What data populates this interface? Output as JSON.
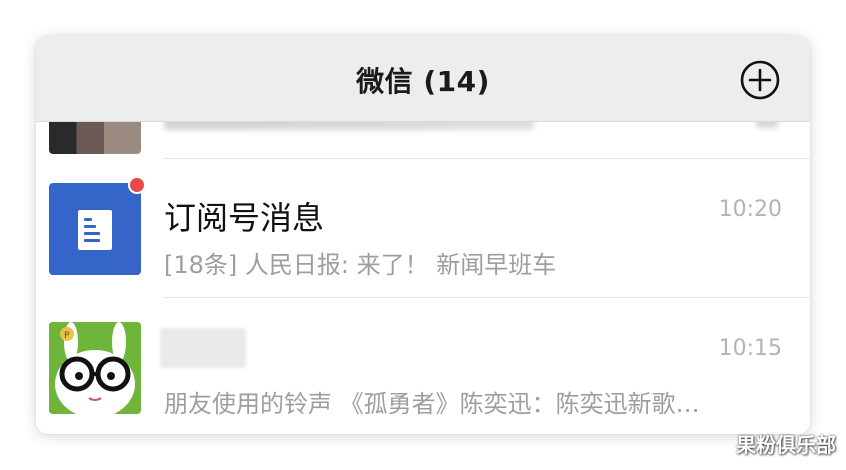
{
  "header": {
    "title": "微信 (14)",
    "add_icon": "plus-circle-icon"
  },
  "chats": [
    {
      "title": "订阅号消息",
      "time": "10:20",
      "preview": "[18条] 人民日报: 来了！ 新闻早班车",
      "avatar_icon": "subscription-document-icon",
      "avatar_color": "#3565c9",
      "unread_dot": true
    },
    {
      "title": "",
      "time": "10:15",
      "preview": "朋友使用的铃声 《孤勇者》陈奕迅：陈奕迅新歌…",
      "avatar_icon": "bunny-glasses-icon",
      "avatar_color": "#6fb53a"
    }
  ],
  "watermark": "果粉俱乐部",
  "colors": {
    "header_bg": "#ededed",
    "unread_dot": "#e84a4a",
    "secondary_text": "#9e9e9e"
  }
}
